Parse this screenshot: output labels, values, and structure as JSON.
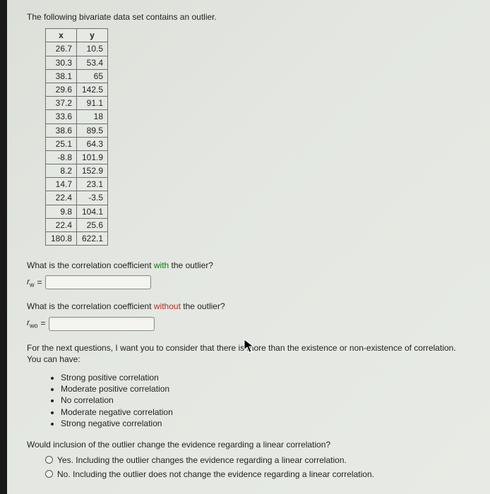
{
  "intro": "The following bivariate data set contains an outlier.",
  "table": {
    "headers": {
      "x": "x",
      "y": "y"
    },
    "rows": [
      {
        "x": "26.7",
        "y": "10.5"
      },
      {
        "x": "30.3",
        "y": "53.4"
      },
      {
        "x": "38.1",
        "y": "65"
      },
      {
        "x": "29.6",
        "y": "142.5"
      },
      {
        "x": "37.2",
        "y": "91.1"
      },
      {
        "x": "33.6",
        "y": "18"
      },
      {
        "x": "38.6",
        "y": "89.5"
      },
      {
        "x": "25.1",
        "y": "64.3"
      },
      {
        "x": "-8.8",
        "y": "101.9"
      },
      {
        "x": "8.2",
        "y": "152.9"
      },
      {
        "x": "14.7",
        "y": "23.1"
      },
      {
        "x": "22.4",
        "y": "-3.5"
      },
      {
        "x": "9.8",
        "y": "104.1"
      },
      {
        "x": "22.4",
        "y": "25.6"
      },
      {
        "x": "180.8",
        "y": "622.1"
      }
    ]
  },
  "q1": {
    "pre": "What is the correlation coefficient ",
    "with": "with",
    "post": " the outlier?",
    "symbol": "r",
    "sub": "w",
    "eq": " = "
  },
  "q2": {
    "pre": "What is the correlation coefficient ",
    "without": "without",
    "post": " the outlier?",
    "symbol": "r",
    "sub": "wo",
    "eq": " = "
  },
  "para": "For the next questions, I want you to consider that there is more than the existence or non-existence of correlation. You can have:",
  "corr_list": [
    "Strong positive correlation",
    "Moderate positive correlation",
    "No correlation",
    "Moderate negative correlation",
    "Strong negative correlation"
  ],
  "q3": "Would inclusion of the outlier change the evidence regarding a linear correlation?",
  "opts": {
    "yes": "Yes. Including the outlier changes the evidence regarding a linear correlation.",
    "no": "No. Including the outlier does not change the evidence regarding a linear correlation."
  }
}
